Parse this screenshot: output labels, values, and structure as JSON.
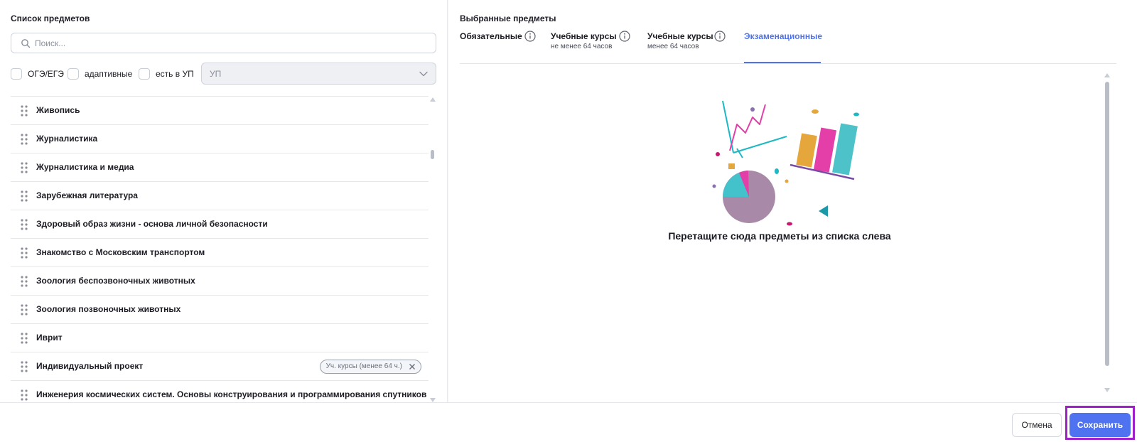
{
  "left_panel": {
    "title": "Список предметов",
    "search": {
      "placeholder": "Поиск...",
      "value": ""
    },
    "filters": [
      {
        "label": "ОГЭ/ЕГЭ",
        "checked": false
      },
      {
        "label": "адаптивные",
        "checked": false
      },
      {
        "label": "есть в УП",
        "checked": false
      }
    ],
    "select": {
      "value": "УП"
    },
    "subjects": [
      {
        "name": "Живопись"
      },
      {
        "name": "Журналистика"
      },
      {
        "name": "Журналистика и медиа"
      },
      {
        "name": "Зарубежная литература"
      },
      {
        "name": "Здоровый образ жизни - основа личной безопасности"
      },
      {
        "name": "Знакомство с Московским транспортом"
      },
      {
        "name": "Зоология беспозвоночных животных"
      },
      {
        "name": "Зоология позвоночных животных"
      },
      {
        "name": "Иврит"
      },
      {
        "name": "Индивидуальный проект",
        "tag": "Уч. курсы (менее 64 ч.)"
      },
      {
        "name": "Инженерия космических систем. Основы конструирования и программирования спутников"
      }
    ]
  },
  "right_panel": {
    "title": "Выбранные предметы",
    "tabs": [
      {
        "label": "Обязательные",
        "sub": ""
      },
      {
        "label": "Учебные курсы",
        "sub": "не менее 64 часов"
      },
      {
        "label": "Учебные курсы",
        "sub": "менее 64 часов"
      },
      {
        "label": "Экзаменационные",
        "sub": "",
        "active": true
      }
    ],
    "empty_text": "Перетащите сюда предметы из списка слева"
  },
  "footer": {
    "cancel_label": "Отмена",
    "save_label": "Сохранить"
  },
  "colors": {
    "accent": "#4f73f0",
    "highlight": "#a020c8"
  }
}
